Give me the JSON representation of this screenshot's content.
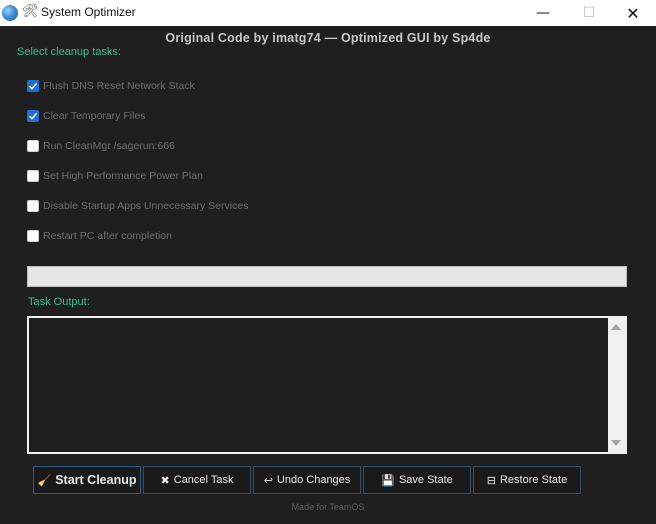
{
  "window": {
    "title": "System Optimizer",
    "app_icon": "globe-icon",
    "title_icon": "tools-icon",
    "controls": {
      "minimize": "—",
      "maximize": "☐",
      "close": "✕"
    }
  },
  "header": {
    "credit": "Original Code by imatg74 — Optimized GUI by Sp4de"
  },
  "tasks_section": {
    "label": "Select cleanup tasks:",
    "items": [
      {
        "label": "Flush DNS  Reset Network Stack",
        "checked": true
      },
      {
        "label": "Clear Temporary Files",
        "checked": true
      },
      {
        "label": "Run CleanMgr /sagerun:666",
        "checked": false
      },
      {
        "label": "Set High Performance Power Plan",
        "checked": false
      },
      {
        "label": "Disable Startup Apps  Unnecessary Services",
        "checked": false
      },
      {
        "label": "Restart PC after completion",
        "checked": false
      }
    ]
  },
  "progress": {
    "fraction": 0
  },
  "output": {
    "label": "Task Output:",
    "text": ""
  },
  "actions": {
    "start": {
      "icon": "🧹",
      "icon_name": "broom-icon",
      "label": "Start Cleanup"
    },
    "cancel": {
      "icon": "✖",
      "icon_name": "x-icon",
      "label": "Cancel Task"
    },
    "undo": {
      "icon": "↩",
      "icon_name": "undo-arrow-icon",
      "label": "Undo Changes"
    },
    "save": {
      "icon": "💾",
      "icon_name": "floppy-disk-icon",
      "label": "Save State"
    },
    "restore": {
      "icon": "⊟",
      "icon_name": "restore-icon",
      "label": "Restore State"
    }
  },
  "footer": {
    "text": "Made for TeamOS"
  },
  "colors": {
    "accent": "#2fbf8f",
    "checkbox": "#1e6fd9",
    "background": "#1f1f1f"
  }
}
